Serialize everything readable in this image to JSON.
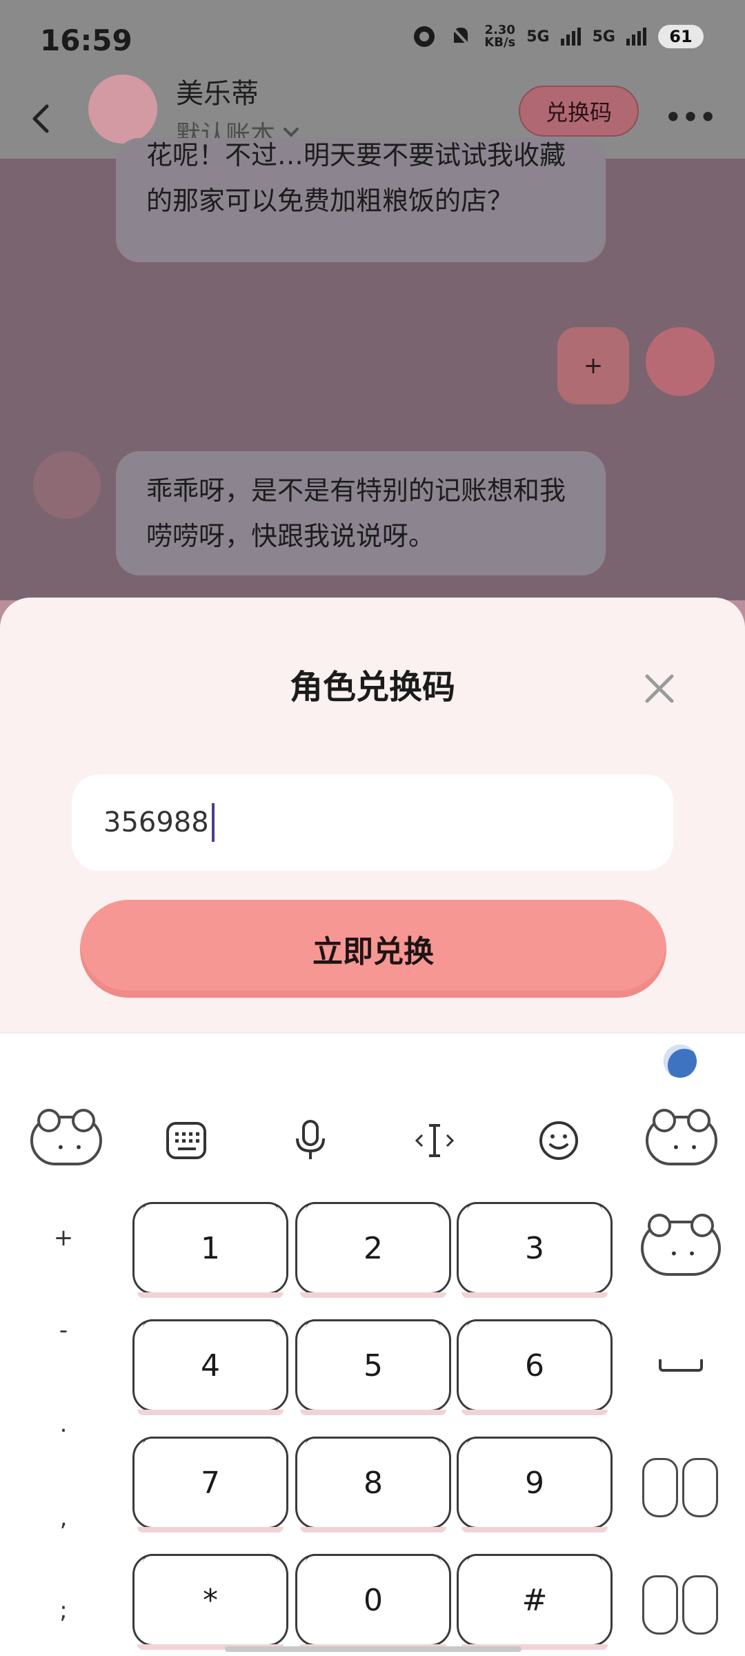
{
  "status_bar": {
    "time": "16:59",
    "net_speed_value": "2.30",
    "net_speed_unit": "KB/s",
    "signal1": "5G",
    "signal2": "5G",
    "battery": "61"
  },
  "header": {
    "contact_name": "美乐蒂",
    "account_label": "默认账本",
    "redeem_label": "兑换码"
  },
  "chat": {
    "message1": "花呢！不过…明天要不要试试我收藏的那家可以免费加粗粮饭的店？",
    "plus_label": "+",
    "message2": "乖乖呀，是不是有特别的记账想和我唠唠呀，快跟我说说呀。"
  },
  "sheet": {
    "title": "角色兑换码",
    "code_value": "356988",
    "submit_label": "立即兑换"
  },
  "keyboard": {
    "symbols": [
      "+",
      "-",
      ".",
      ",",
      ";"
    ],
    "keys": [
      "1",
      "2",
      "3",
      "4",
      "5",
      "6",
      "7",
      "8",
      "9",
      "*",
      "0",
      "#"
    ]
  },
  "colors": {
    "accent": "#f69793",
    "sheet_bg": "#fbf1f1",
    "overlay": "#7a6470"
  }
}
